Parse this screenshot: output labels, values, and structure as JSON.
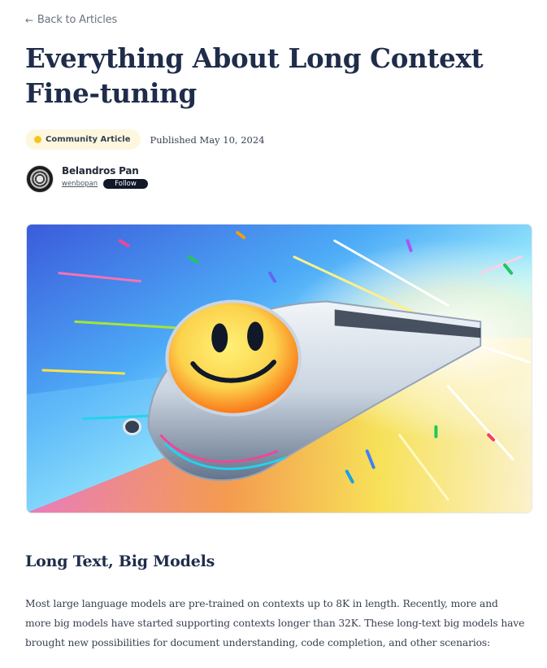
{
  "nav": {
    "back_label": "Back to Articles",
    "back_icon": "arrow-left-icon"
  },
  "article": {
    "title": "Everything About Long Context Fine-tuning",
    "badge_label": "Community Article",
    "badge_icon": "community-dot-icon",
    "published_label": "Published",
    "published_date": "May 10, 2024",
    "author": {
      "name": "Belandros Pan",
      "handle": "wenbopan",
      "follow_label": "Follow"
    },
    "hero_image_subject": "smiley-face bullet train speeding through colorful light streaks",
    "section_heading": "Long Text, Big Models",
    "paragraph": "Most large language models are pre-trained on contexts up to 8K in length. Recently, more and more big models have started supporting contexts longer than 32K. These long-text big models have brought new possibilities for document understanding, code completion, and other scenarios:"
  },
  "colors": {
    "title": "#1f2d4a",
    "badge_bg": "#fef7e0",
    "follow_bg": "#111827"
  }
}
